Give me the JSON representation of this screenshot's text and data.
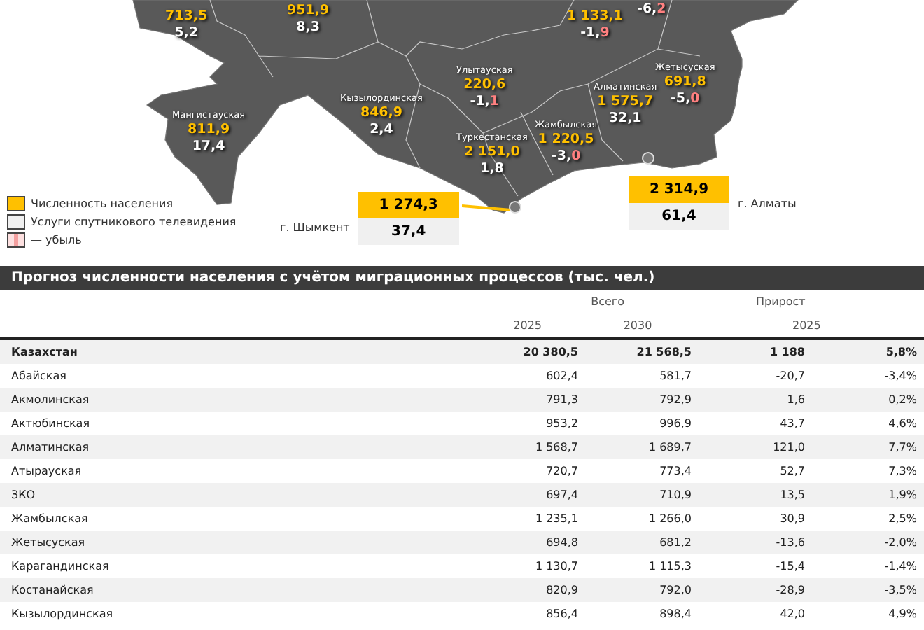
{
  "map": {
    "regions": [
      {
        "population": "713,5",
        "growth": "5,2",
        "decline": false
      },
      {
        "population": "951,9",
        "growth": "8,3",
        "decline": false
      },
      {
        "population": "1 133,1",
        "growth": "-1,9",
        "decline": true
      },
      {
        "growth": "-6,2",
        "decline": true
      },
      {
        "name": "Улытауская",
        "population": "220,6",
        "growth": "-1,1",
        "decline": true
      },
      {
        "name": "Жетысуская",
        "population": "691,8",
        "growth": "-5,0",
        "decline": true
      },
      {
        "name": "Алматинская",
        "population": "1 575,7",
        "growth": "32,1",
        "decline": false
      },
      {
        "name": "Мангистауская",
        "population": "811,9",
        "growth": "17,4",
        "decline": false
      },
      {
        "name": "Кызылординская",
        "population": "846,9",
        "growth": "2,4",
        "decline": false
      },
      {
        "name": "Жамбылская",
        "population": "1 220,5",
        "growth": "-3,0",
        "decline": true
      },
      {
        "name": "Туркестанская",
        "population": "2 151,0",
        "growth": "1,8",
        "decline": false
      }
    ],
    "cities": [
      {
        "name": "г. Шымкент",
        "population": "1 274,3",
        "growth": "37,4"
      },
      {
        "name": "г. Алматы",
        "population": "2 314,9",
        "growth": "61,4"
      }
    ],
    "legend": [
      {
        "kind": "population",
        "label": "Численность населения"
      },
      {
        "kind": "satellite",
        "label": "Услуги спутникового телевидения"
      },
      {
        "kind": "decline",
        "label": "— убыль"
      }
    ]
  },
  "table": {
    "title": "Прогноз численности населения с учётом миграционных процессов (тыс. чел.)",
    "groups": [
      "Всего",
      "Прирост"
    ],
    "years": [
      "2025",
      "2030",
      "2025"
    ],
    "rows": [
      {
        "region": "Казахстан",
        "total": true,
        "cells": [
          "20 380,5",
          "21 568,5",
          "1 188",
          "5,8%"
        ]
      },
      {
        "region": "Абайская",
        "total": false,
        "cells": [
          "602,4",
          "581,7",
          "-20,7",
          "-3,4%"
        ]
      },
      {
        "region": "Акмолинская",
        "total": false,
        "cells": [
          "791,3",
          "792,9",
          "1,6",
          "0,2%"
        ]
      },
      {
        "region": "Актюбинская",
        "total": false,
        "cells": [
          "953,2",
          "996,9",
          "43,7",
          "4,6%"
        ]
      },
      {
        "region": "Алматинская",
        "total": false,
        "cells": [
          "1 568,7",
          "1 689,7",
          "121,0",
          "7,7%"
        ]
      },
      {
        "region": "Атырауская",
        "total": false,
        "cells": [
          "720,7",
          "773,4",
          "52,7",
          "7,3%"
        ]
      },
      {
        "region": "ЗКО",
        "total": false,
        "cells": [
          "697,4",
          "710,9",
          "13,5",
          "1,9%"
        ]
      },
      {
        "region": "Жамбылская",
        "total": false,
        "cells": [
          "1 235,1",
          "1 266,0",
          "30,9",
          "2,5%"
        ]
      },
      {
        "region": "Жетысуская",
        "total": false,
        "cells": [
          "694,8",
          "681,2",
          "-13,6",
          "-2,0%"
        ]
      },
      {
        "region": "Карагандинская",
        "total": false,
        "cells": [
          "1 130,7",
          "1 115,3",
          "-15,4",
          "-1,4%"
        ]
      },
      {
        "region": "Костанайская",
        "total": false,
        "cells": [
          "820,9",
          "792,0",
          "-28,9",
          "-3,5%"
        ]
      },
      {
        "region": "Кызылординская",
        "total": false,
        "cells": [
          "856,4",
          "898,4",
          "42,0",
          "4,9%"
        ]
      }
    ]
  }
}
